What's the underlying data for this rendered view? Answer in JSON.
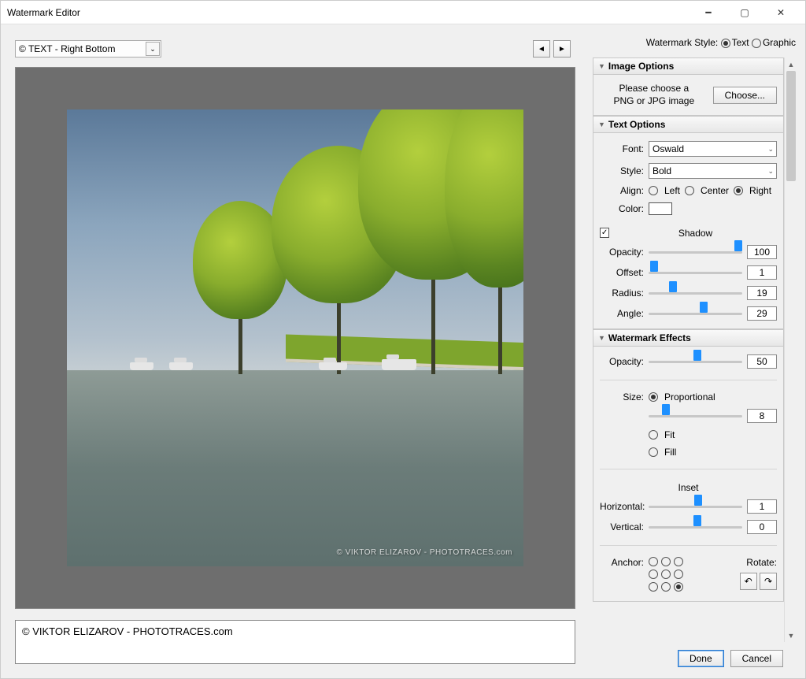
{
  "window": {
    "title": "Watermark Editor"
  },
  "preset": {
    "selected": "© TEXT - Right Bottom"
  },
  "styleRow": {
    "label": "Watermark Style:",
    "textOpt": "Text",
    "graphicOpt": "Graphic",
    "selected": "Text"
  },
  "imageOptions": {
    "header": "Image Options",
    "prompt1": "Please choose a",
    "prompt2": "PNG or JPG image",
    "chooseBtn": "Choose..."
  },
  "textOptions": {
    "header": "Text Options",
    "fontLabel": "Font:",
    "fontValue": "Oswald",
    "styleLabel": "Style:",
    "styleValue": "Bold",
    "alignLabel": "Align:",
    "alignOpts": {
      "left": "Left",
      "center": "Center",
      "right": "Right"
    },
    "alignSelected": "Right",
    "colorLabel": "Color:",
    "colorValue": "#ffffff",
    "shadow": {
      "label": "Shadow",
      "enabled": true,
      "opacityLabel": "Opacity:",
      "opacity": 100,
      "offsetLabel": "Offset:",
      "offset": 1,
      "radiusLabel": "Radius:",
      "radius": 19,
      "angleLabel": "Angle:",
      "angle": 29
    }
  },
  "watermarkEffects": {
    "header": "Watermark Effects",
    "opacityLabel": "Opacity:",
    "opacity": 50,
    "sizeLabel": "Size:",
    "sizeMode": "Proportional",
    "sizeOpts": {
      "prop": "Proportional",
      "fit": "Fit",
      "fill": "Fill"
    },
    "sizeValue": 8,
    "inset": {
      "label": "Inset",
      "horizLabel": "Horizontal:",
      "horiz": 1,
      "vertLabel": "Vertical:",
      "vert": 0
    },
    "anchorLabel": "Anchor:",
    "anchor": "bottom-right",
    "rotateLabel": "Rotate:"
  },
  "watermarkText": "© VIKTOR ELIZAROV - PHOTOTRACES.com",
  "watermarkOnImage": "© VIKTOR ELIZAROV - PHOTOTRACES.com",
  "footer": {
    "done": "Done",
    "cancel": "Cancel"
  }
}
